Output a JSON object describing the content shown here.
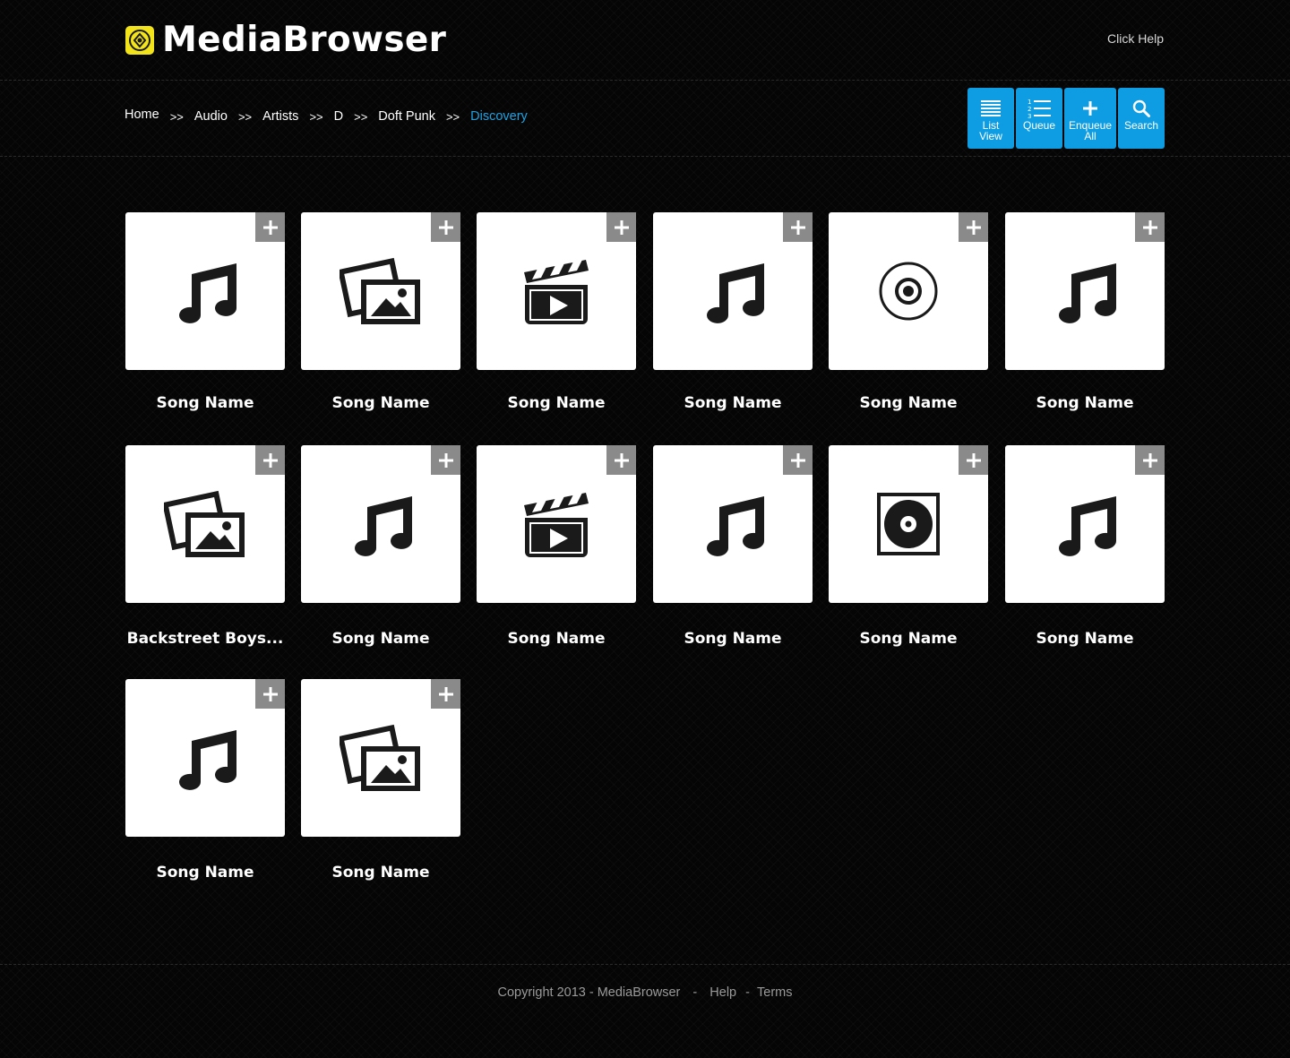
{
  "header": {
    "app_title": "MediaBrowser",
    "help_link": "Click Help"
  },
  "breadcrumb": {
    "items": [
      "Home",
      "Audio",
      "Artists",
      "D",
      "Doft Punk",
      "Discovery"
    ],
    "separator": ">>",
    "current_color": "#1fa1e1"
  },
  "toolbar": {
    "buttons": [
      {
        "label_line1": "List",
        "label_line2": "View",
        "icon": "list-icon"
      },
      {
        "label_line1": "Queue",
        "label_line2": "",
        "icon": "numbered-list-icon"
      },
      {
        "label_line1": "Enqueue",
        "label_line2": "All",
        "icon": "plus-icon"
      },
      {
        "label_line1": "Search",
        "label_line2": "",
        "icon": "search-icon"
      }
    ],
    "accent": "#0e9de2"
  },
  "items": [
    {
      "caption": "Song Name",
      "icon": "music-note-icon"
    },
    {
      "caption": "Song Name",
      "icon": "photos-icon"
    },
    {
      "caption": "Song Name",
      "icon": "clapperboard-icon"
    },
    {
      "caption": "Song Name",
      "icon": "music-note-icon"
    },
    {
      "caption": "Song Name",
      "icon": "disc-icon"
    },
    {
      "caption": "Song Name",
      "icon": "music-note-icon"
    },
    {
      "caption": "Backstreet Boys...",
      "icon": "photos-icon"
    },
    {
      "caption": "Song Name",
      "icon": "music-note-icon"
    },
    {
      "caption": "Song Name",
      "icon": "clapperboard-icon"
    },
    {
      "caption": "Song Name",
      "icon": "music-note-icon"
    },
    {
      "caption": "Song Name",
      "icon": "record-box-icon"
    },
    {
      "caption": "Song Name",
      "icon": "music-note-icon"
    },
    {
      "caption": "Song Name",
      "icon": "music-note-icon"
    },
    {
      "caption": "Song Name",
      "icon": "photos-icon"
    }
  ],
  "footer": {
    "copyright": "Copyright 2013 - MediaBrowser",
    "dash1": "-",
    "help": "Help",
    "dash2": "-",
    "terms": "Terms"
  }
}
